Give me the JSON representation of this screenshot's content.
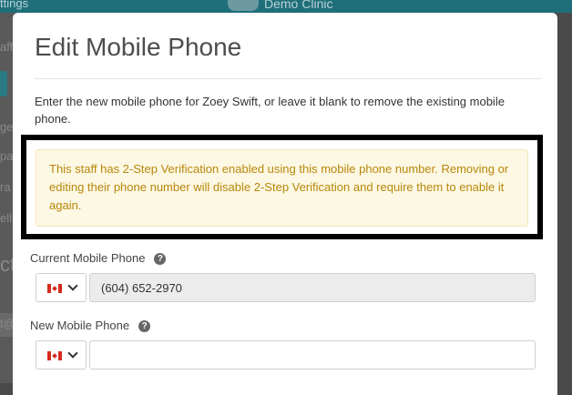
{
  "background": {
    "topbar_left": "ttings",
    "topbar_center": "Demo Clinic",
    "left_fragments": [
      "aff",
      "ge",
      "pa",
      "ra",
      "ell",
      "ct",
      "t@"
    ]
  },
  "modal": {
    "title": "Edit Mobile Phone",
    "intro": "Enter the new mobile phone for Zoey Swift, or leave it blank to remove the existing mobile phone.",
    "warning": "This staff has 2-Step Verification enabled using this mobile phone number. Removing or editing their phone number will disable 2-Step Verification and require them to enable it again.",
    "current_phone": {
      "label": "Current Mobile Phone",
      "value": "(604) 652-2970",
      "country": "CA"
    },
    "new_phone": {
      "label": "New Mobile Phone",
      "value": "",
      "placeholder": "",
      "country": "CA"
    }
  },
  "colors": {
    "warning_text": "#b8860b",
    "warning_bg": "#fcf8e3",
    "highlight_border": "#000000",
    "topbar": "#1f6f7a"
  }
}
